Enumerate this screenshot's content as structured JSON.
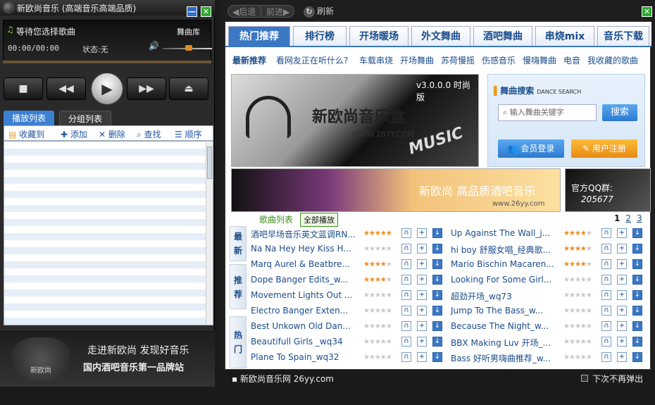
{
  "player": {
    "title": "新欧尚音乐 (高端音乐高端品质)",
    "minimize": "—",
    "close": "✕",
    "now_playing": "等待您选择歌曲",
    "library_label": "舞曲库",
    "time": "00:00/00:00",
    "status": "状态:无",
    "controls": {
      "stop": "■",
      "prev": "◀◀",
      "play": "▶",
      "next": "▶▶",
      "eject": "⏏"
    },
    "tabs": [
      "播放列表",
      "分组列表"
    ],
    "toolbar": [
      "收藏到",
      "添加",
      "删除",
      "查找",
      "顺序"
    ],
    "banner_line1": "走进新欧尚 发现好音乐",
    "banner_line2": "国内酒吧音乐第一品牌站",
    "logo_text": "新欧尚"
  },
  "browser": {
    "back": "后退",
    "forward": "前进",
    "refresh": "刷新",
    "close": "✕",
    "tabs": [
      "热门推荐",
      "排行榜",
      "开场暖场",
      "外文舞曲",
      "酒吧舞曲",
      "串烧mix",
      "音乐下载"
    ],
    "subnav": [
      "最新推荐",
      "看网友正在听什么?",
      "车载串烧",
      "开场舞曲",
      "苏荷慢摇",
      "伤感音乐",
      "慢嗨舞曲",
      "电音",
      "我收藏的歌曲"
    ],
    "ad_big": {
      "version": "v3.0.0.0 时尚版",
      "brand": "新欧尚音乐盒",
      "url": "WWW.26YY.COM",
      "tag": "MUSIC"
    },
    "search": {
      "title": "舞曲搜索",
      "title_en": "DANCE SEARCH",
      "placeholder": "输入舞曲关键字",
      "button": "搜索",
      "login": "会员登录",
      "register": "用户注册"
    },
    "ad_wide": {
      "text": "新欧尚 高品质酒吧音乐",
      "url": "www.26yy.com"
    },
    "ad_qq": {
      "line1": "官方QQ群:",
      "line2": "205677"
    },
    "list_label": "歌曲列表",
    "play_all": "全部播放",
    "pages": [
      "1",
      "2",
      "3"
    ],
    "sections": [
      "最新",
      "推荐",
      "热门"
    ],
    "songs_left": [
      {
        "title": "酒吧早场音乐英文蓝调RN...",
        "rating": 5
      },
      {
        "title": "Na Na Hey Hey Kiss H...",
        "rating": 0
      },
      {
        "title": "Marq Aurel & Beatbre...",
        "rating": 4
      },
      {
        "title": "Dope Banger Edits_w...",
        "rating": 4
      },
      {
        "title": "Movement Lights Out ...",
        "rating": 0
      },
      {
        "title": "Electro Banger Exten...",
        "rating": 0
      },
      {
        "title": "Best Unkown Old Dan...",
        "rating": 0
      },
      {
        "title": "Beautifull Girls _wq34",
        "rating": 0
      },
      {
        "title": "Plane To Spain_wq32",
        "rating": 0
      }
    ],
    "songs_right": [
      {
        "title": "Up Against The Wall_j...",
        "rating": 4
      },
      {
        "title": "hi boy 舒服女唱_经典歌...",
        "rating": 4
      },
      {
        "title": "Mario Bischin Macaren...",
        "rating": 4
      },
      {
        "title": "Looking For Some Girl...",
        "rating": 0
      },
      {
        "title": "超劲开场_wq73",
        "rating": 0
      },
      {
        "title": "Jump To The Bass_w...",
        "rating": 0
      },
      {
        "title": "Because The Night_w...",
        "rating": 0
      },
      {
        "title": "BBX Making Luv 开场_...",
        "rating": 0
      },
      {
        "title": "Bass 好听男嗨曲推荐_w...",
        "rating": 0
      }
    ],
    "status_left": "新欧尚音乐网 26yy.com",
    "status_right": "下次不再弹出"
  }
}
